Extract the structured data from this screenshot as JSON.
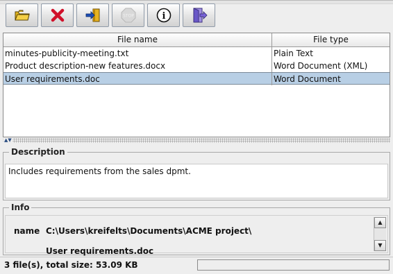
{
  "toolbar": {
    "buttons": [
      {
        "icon": "open-folder-icon"
      },
      {
        "icon": "delete-x-icon"
      },
      {
        "icon": "import-icon"
      },
      {
        "icon": "stop-icon",
        "label": "STOP",
        "disabled": true
      },
      {
        "icon": "info-icon",
        "label": "i"
      },
      {
        "icon": "exit-door-icon"
      }
    ]
  },
  "table": {
    "columns": [
      "File name",
      "File type"
    ],
    "rows": [
      {
        "name": "minutes-publicity-meeting.txt",
        "type": "Plain Text"
      },
      {
        "name": "Product description-new features.docx",
        "type": "Word Document (XML)"
      },
      {
        "name": "User requirements.doc",
        "type": "Word Document",
        "selected": true
      }
    ]
  },
  "description": {
    "title": "Description",
    "text": "Includes requirements from the sales dpmt."
  },
  "info": {
    "title": "Info",
    "key": "name",
    "path_line1": "C:\\Users\\kreifelts\\Documents\\ACME project\\",
    "path_line2": "User requirements.doc"
  },
  "status": {
    "text": "3 file(s), total size: 53.09 KB"
  },
  "colors": {
    "selection": "#b8cfe5",
    "background": "#eeeeee"
  }
}
